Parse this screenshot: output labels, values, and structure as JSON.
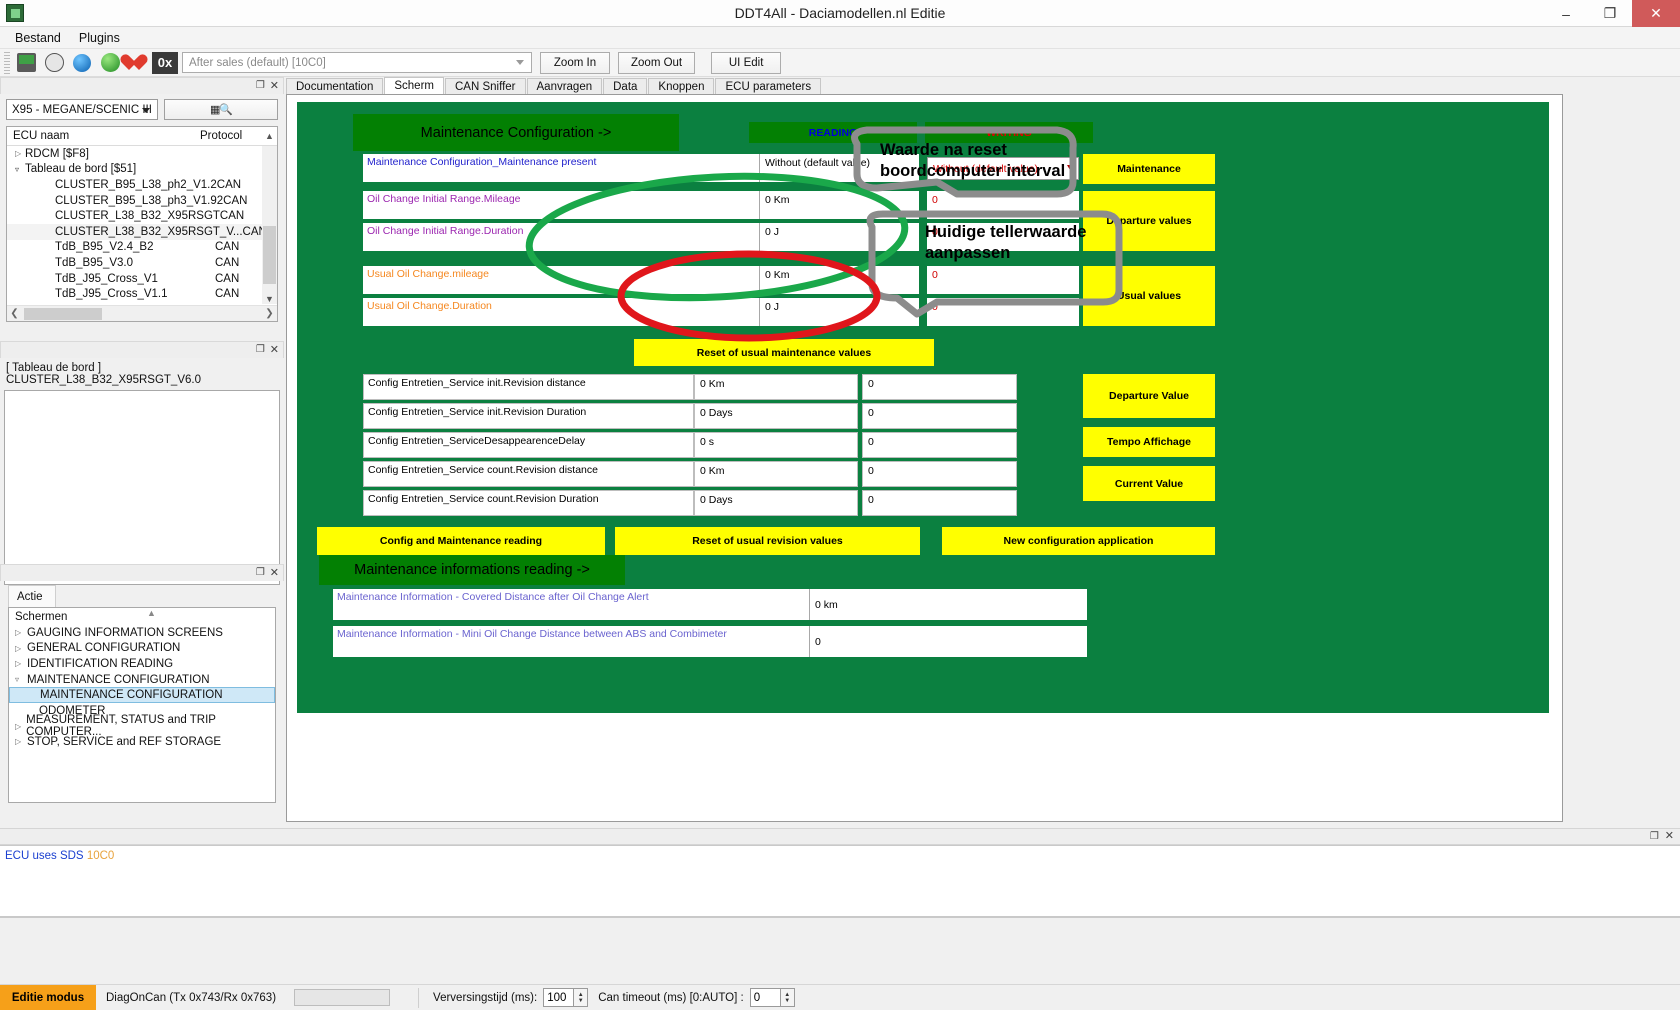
{
  "window": {
    "title": "DDT4All - Daciamodellen.nl Editie",
    "minimize": "–",
    "maximize": "❐",
    "close": "✕"
  },
  "menubar": {
    "items": [
      "Bestand",
      "Plugins"
    ]
  },
  "toolbar": {
    "icons": [
      "device-icon",
      "face-icon",
      "blue-sphere-icon",
      "green-refresh-icon",
      "heart-plus-icon",
      "hex-0x-icon"
    ],
    "hex_label": "0x",
    "combo_value": "After sales (default) [10C0]",
    "buttons": [
      "Zoom In",
      "Zoom Out",
      "UI Edit"
    ]
  },
  "tabs": {
    "items": [
      "Documentation",
      "Scherm",
      "CAN Sniffer",
      "Aanvragen",
      "Data",
      "Knoppen",
      "ECU parameters"
    ],
    "active": "Scherm"
  },
  "sidebar": {
    "vehicle_select": "X95 - MEGANE/SCENIC III",
    "search_icon": "qr-search-icon",
    "ecu_tree": {
      "columns": [
        "ECU naam",
        "Protocol"
      ],
      "rows": [
        {
          "label": "RDCM [$F8]",
          "protocol": "",
          "indent": 0,
          "arrow": "closed"
        },
        {
          "label": "Tableau de bord [$51]",
          "protocol": "",
          "indent": 0,
          "arrow": "open"
        },
        {
          "label": "CLUSTER_B95_L38_ph2_V1.2",
          "protocol": "CAN",
          "indent": 2,
          "arrow": ""
        },
        {
          "label": "CLUSTER_B95_L38_ph3_V1.92",
          "protocol": "CAN",
          "indent": 2,
          "arrow": ""
        },
        {
          "label": "CLUSTER_L38_B32_X95RSGT",
          "protocol": "CAN",
          "indent": 2,
          "arrow": ""
        },
        {
          "label": "CLUSTER_L38_B32_X95RSGT_V...",
          "protocol": "CAN",
          "indent": 2,
          "arrow": "",
          "selected": true
        },
        {
          "label": "TdB_B95_V2.4_B2",
          "protocol": "CAN",
          "indent": 2,
          "arrow": ""
        },
        {
          "label": "TdB_B95_V3.0",
          "protocol": "CAN",
          "indent": 2,
          "arrow": ""
        },
        {
          "label": "TdB_J95_Cross_V1",
          "protocol": "CAN",
          "indent": 2,
          "arrow": ""
        },
        {
          "label": "TdB_J95_Cross_V1.1",
          "protocol": "CAN",
          "indent": 2,
          "arrow": ""
        }
      ]
    },
    "ecu_title": "[ Tableau de bord ] CLUSTER_L38_B32_X95RSGT_V6.0",
    "actie_tab": "Actie",
    "screens_header": "Schermen",
    "screens": [
      {
        "label": "GAUGING INFORMATION SCREENS",
        "arrow": "closed",
        "indent": 0
      },
      {
        "label": "GENERAL CONFIGURATION",
        "arrow": "closed",
        "indent": 0
      },
      {
        "label": "IDENTIFICATION READING",
        "arrow": "closed",
        "indent": 0
      },
      {
        "label": "MAINTENANCE CONFIGURATION",
        "arrow": "open",
        "indent": 0
      },
      {
        "label": "MAINTENANCE CONFIGURATION",
        "arrow": "",
        "indent": 1,
        "selected": true
      },
      {
        "label": "ODOMETER",
        "arrow": "",
        "indent": 1
      },
      {
        "label": "MEASUREMENT, STATUS and TRIP COMPUTER...",
        "arrow": "closed",
        "indent": 0
      },
      {
        "label": "STOP, SERVICE and REF STORAGE",
        "arrow": "closed",
        "indent": 0
      }
    ]
  },
  "screen": {
    "header_title": "Maintenance Configuration ->",
    "col_reading": "READING",
    "col_writing": "WRITING",
    "rows_top": [
      {
        "label": "Maintenance Configuration_Maintenance present",
        "color": "blue",
        "reading": "Without (default value)",
        "writing": "Without (default value)",
        "writing_type": "combo"
      },
      {
        "label": "Oil Change Initial Range.Mileage",
        "color": "purple",
        "reading": "0 Km",
        "writing": "0",
        "writing_type": "text"
      },
      {
        "label": "Oil Change Initial Range.Duration",
        "color": "purple",
        "reading": "0 J",
        "writing": "0",
        "writing_type": "text"
      },
      {
        "label": "Usual Oil Change.mileage",
        "color": "orange",
        "reading": "0 Km",
        "writing": "0",
        "writing_type": "text"
      },
      {
        "label": "Usual Oil Change.Duration",
        "color": "orange",
        "reading": "0 J",
        "writing": "0",
        "writing_type": "text"
      }
    ],
    "side_buttons_top": [
      "Maintenance",
      "Departure values",
      "Usual values"
    ],
    "reset_usual_button": "Reset of usual maintenance values",
    "rows_mid": [
      {
        "label": "Config Entretien_Service init.Revision distance",
        "reading": "0 Km",
        "writing": "0"
      },
      {
        "label": "Config Entretien_Service init.Revision Duration",
        "reading": "0 Days",
        "writing": "0"
      },
      {
        "label": "Config Entretien_ServiceDesappearenceDelay",
        "reading": "0 s",
        "writing": "0"
      },
      {
        "label": "Config Entretien_Service count.Revision distance",
        "reading": "0 Km",
        "writing": "0"
      },
      {
        "label": "Config Entretien_Service count.Revision Duration",
        "reading": "0 Days",
        "writing": "0"
      }
    ],
    "side_buttons_mid": [
      "Departure Value",
      "Tempo Affichage",
      "Current Value"
    ],
    "bottom_buttons": [
      "Config and Maintenance reading",
      "Reset of usual revision values",
      "New configuration application"
    ],
    "info_header": "Maintenance informations reading ->",
    "rows_info": [
      {
        "label": "Maintenance Information - Covered Distance after Oil Change Alert",
        "value": "0 km"
      },
      {
        "label": "Maintenance Information - Mini Oil Change Distance between ABS and Combimeter",
        "value": "0"
      }
    ]
  },
  "annotations": [
    {
      "text": "Waarde na reset\nboordcomputer interval",
      "shape": "gray-rounded-box"
    },
    {
      "text": "Huidige tellerwaarde\naanpassen",
      "shape": "gray-rounded-box"
    },
    {
      "text": "",
      "shape": "green-ellipse"
    },
    {
      "text": "",
      "shape": "red-ellipse"
    }
  ],
  "log": {
    "line_blue": "ECU uses SDS",
    "line_orange": "10C0"
  },
  "statusbar": {
    "mode": "Editie modus",
    "connection": "DiagOnCan (Tx 0x743/Rx 0x763)",
    "refresh_label": "Verversingstijd (ms):",
    "refresh_value": "100",
    "timeout_label": "Can timeout (ms) [0:AUTO] :",
    "timeout_value": "0"
  },
  "colors": {
    "stage_green": "#0b8040",
    "header_green": "#038003",
    "yellow": "#ffff00",
    "reading_blue": "#0000d8",
    "writing_red": "#e00000",
    "accent_orange": "#f6a019",
    "anno_gray": "#8c8c8c",
    "anno_green": "#1aa84a",
    "anno_red": "#e0161b"
  }
}
